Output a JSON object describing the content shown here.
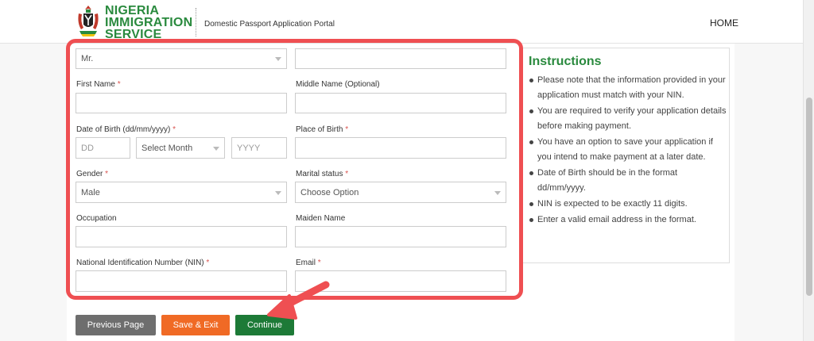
{
  "header": {
    "logo_lines": [
      "NIGERIA",
      "IMMIGRATION",
      "SERVICE"
    ],
    "portal_title": "Domestic Passport Application Portal",
    "nav_home": "HOME"
  },
  "form": {
    "title_select_value": "Mr.",
    "surname_value": "",
    "first_name_label": "First Name",
    "middle_name_label": "Middle Name (Optional)",
    "dob_label": "Date of Birth (dd/mm/yyyy)",
    "dob_day_placeholder": "DD",
    "dob_month_value": "Select Month",
    "dob_year_placeholder": "YYYY",
    "place_of_birth_label": "Place of Birth",
    "gender_label": "Gender",
    "gender_value": "Male",
    "marital_label": "Marital status",
    "marital_value": "Choose Option",
    "occupation_label": "Occupation",
    "maiden_name_label": "Maiden Name",
    "nin_label": "National Identification Number (NIN)",
    "email_label": "Email",
    "required_mark": "*"
  },
  "instructions": {
    "title": "Instructions",
    "items": [
      "Please note that the information provided in your application must match with your NIN.",
      "You are required to verify your application details before making payment.",
      "You have an option to save your application if you intend to make payment at a later date.",
      "Date of Birth should be in the format dd/mm/yyyy.",
      "NIN is expected to be exactly 11 digits.",
      "Enter a valid email address in the format."
    ]
  },
  "buttons": {
    "previous": "Previous Page",
    "save_exit": "Save & Exit",
    "continue": "Continue"
  },
  "colors": {
    "brand_green": "#2a8a3e",
    "annotation_red": "#ef4f52",
    "btn_previous": "#6e6e6e",
    "btn_save": "#f06a25",
    "btn_continue": "#1d7a37"
  }
}
